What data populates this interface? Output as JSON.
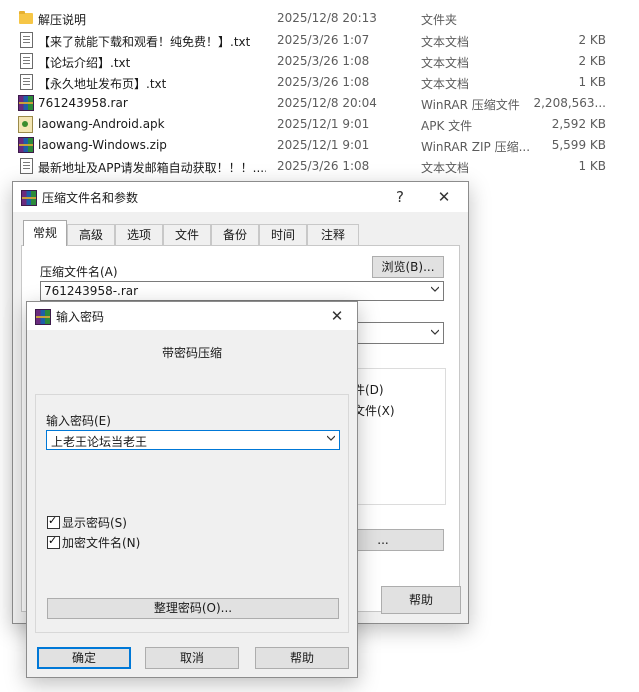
{
  "files": [
    {
      "icon": "folder-icon",
      "name": "解压说明",
      "date": "2025/12/8 20:13",
      "type": "文件夹",
      "size": ""
    },
    {
      "icon": "text-document-icon",
      "name": "【来了就能下载和观看！纯免费！】.txt",
      "date": "2025/3/26 1:07",
      "type": "文本文档",
      "size": "2 KB"
    },
    {
      "icon": "text-document-icon",
      "name": "【论坛介绍】.txt",
      "date": "2025/3/26 1:08",
      "type": "文本文档",
      "size": "2 KB"
    },
    {
      "icon": "text-document-icon",
      "name": "【永久地址发布页】.txt",
      "date": "2025/3/26 1:08",
      "type": "文本文档",
      "size": "1 KB"
    },
    {
      "icon": "rar-archive-icon",
      "name": "761243958.rar",
      "date": "2025/12/8 20:04",
      "type": "WinRAR 压缩文件",
      "size": "2,208,563..."
    },
    {
      "icon": "apk-file-icon",
      "name": "laowang-Android.apk",
      "date": "2025/12/1 9:01",
      "type": "APK 文件",
      "size": "2,592 KB"
    },
    {
      "icon": "zip-archive-icon",
      "name": "laowang-Windows.zip",
      "date": "2025/12/1 9:01",
      "type": "WinRAR ZIP 压缩...",
      "size": "5,599 KB"
    },
    {
      "icon": "text-document-icon",
      "name": "最新地址及APP请发邮箱自动获取！！！....",
      "date": "2025/3/26 1:08",
      "type": "文本文档",
      "size": "1 KB"
    }
  ],
  "params_dialog": {
    "title": "压缩文件名和参数",
    "help_glyph": "?",
    "close_glyph": "✕",
    "tabs": [
      "常规",
      "高级",
      "选项",
      "文件",
      "备份",
      "时间",
      "注释"
    ],
    "archive_name_label": "压缩文件名(A)",
    "browse_button": "浏览(B)...",
    "archive_name_value": "761243958-.rar",
    "option_1": "件(D)",
    "option_2": "文件(X)",
    "partial_button": "...",
    "help_button": "帮助"
  },
  "password_dialog": {
    "title": "输入密码",
    "close_glyph": "✕",
    "heading": "带密码压缩",
    "password_label": "输入密码(E)",
    "password_value": "上老王论坛当老王",
    "show_password": "显示密码(S)",
    "encrypt_names": "加密文件名(N)",
    "organize_button": "整理密码(O)...",
    "ok_button": "确定",
    "cancel_button": "取消",
    "help_button": "帮助"
  }
}
